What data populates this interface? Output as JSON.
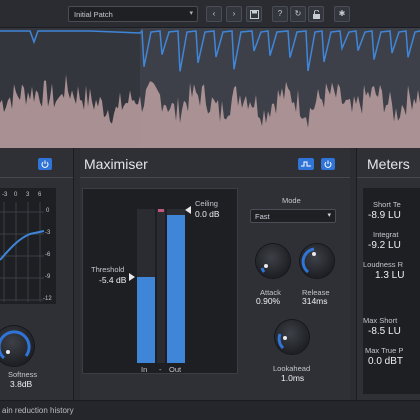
{
  "toolbar": {
    "preset_name": "Initial Patch",
    "buttons": [
      "prev",
      "next",
      "save",
      "help",
      "refresh",
      "unlock",
      "settings"
    ]
  },
  "history": {
    "label": "ain reduction history"
  },
  "left_panel": {
    "grid_top_labels": [
      "-3",
      "0",
      "3",
      "6"
    ],
    "grid_right_labels": [
      "0",
      "-3",
      "-6",
      "-9",
      "-12"
    ],
    "softness_label": "Softness",
    "softness_value": "3.8dB"
  },
  "maximiser": {
    "title": "Maximiser",
    "threshold_label": "Threshold",
    "threshold_value": "-5.4 dB",
    "ceiling_label": "Ceiling",
    "ceiling_value": "0.0 dB",
    "in_label": "In",
    "dash_label": "-",
    "out_label": "Out",
    "in_level": 0.56,
    "out_level": 0.96,
    "mode_label": "Mode",
    "mode_value": "Fast",
    "attack_label": "Attack",
    "attack_value": "0.90%",
    "release_label": "Release",
    "release_value": "314ms",
    "lookahead_label": "Lookahead",
    "lookahead_value": "1.0ms"
  },
  "meters": {
    "title": "Meters",
    "short_term_label": "Short Te",
    "short_term_value": "-8.9 LU",
    "integrated_label": "Integrat",
    "integrated_value": "-9.2 LU",
    "loudness_range_label": "Loudness R",
    "loudness_range_value": "1.3 LU",
    "max_short_label": "Max Short",
    "max_short_value": "-8.5 LU",
    "max_true_label": "Max True P",
    "max_true_value": "0.0 dBT"
  },
  "colors": {
    "accent": "#2f74d6",
    "meter_blue": "#3f86d8",
    "history_bg": "#3d4048",
    "waveform": "#c9a9a9"
  }
}
